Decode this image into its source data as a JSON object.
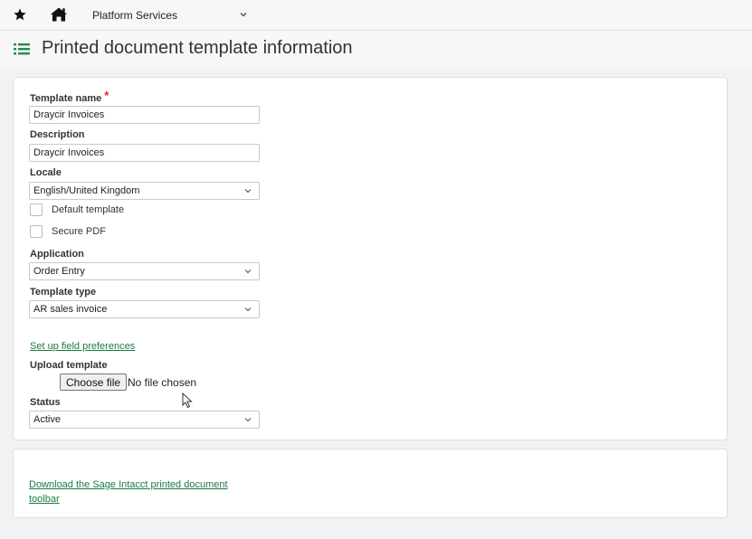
{
  "topbar": {
    "app_menu_label": "Platform Services"
  },
  "page": {
    "title": "Printed document template information"
  },
  "form": {
    "template_name": {
      "label": "Template name",
      "required_mark": "*",
      "value": "Draycir Invoices"
    },
    "description": {
      "label": "Description",
      "value": "Draycir Invoices"
    },
    "locale": {
      "label": "Locale",
      "value": "English/United Kingdom"
    },
    "default_template": {
      "label": "Default template",
      "checked": false
    },
    "secure_pdf": {
      "label": "Secure PDF",
      "checked": false
    },
    "application": {
      "label": "Application",
      "value": "Order Entry"
    },
    "template_type": {
      "label": "Template type",
      "value": "AR sales invoice"
    },
    "field_prefs_link": "Set up field preferences",
    "upload": {
      "label": "Upload template",
      "button": "Choose file",
      "status": "No file chosen"
    },
    "status": {
      "label": "Status",
      "value": "Active"
    }
  },
  "download": {
    "link_line1": "Download the Sage Intacct printed document",
    "link_line2": "toolbar"
  },
  "colors": {
    "link": "#1b7a43",
    "accent_icon": "#2a8a4c",
    "required": "#d9292b"
  }
}
